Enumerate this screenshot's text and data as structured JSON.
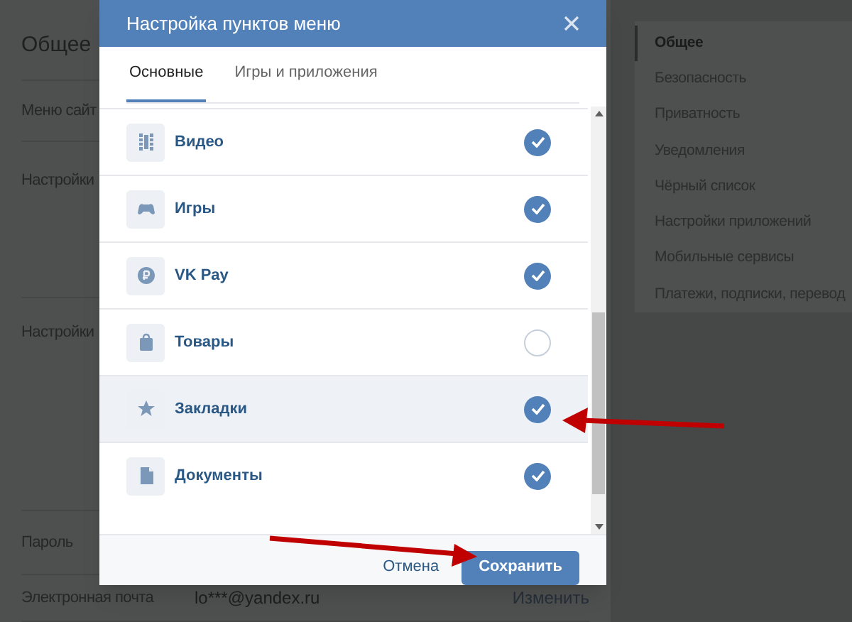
{
  "page": {
    "section_title": "Общее",
    "rows": [
      {
        "label": "Меню сайт"
      },
      {
        "label": "Настройки"
      },
      {
        "label": "Настройки"
      },
      {
        "label": "Пароль"
      },
      {
        "label": "Электронная почта",
        "value": "lo***@yandex.ru",
        "action": "Изменить"
      }
    ]
  },
  "sidebar": {
    "items": [
      {
        "label": "Общее",
        "selected": true
      },
      {
        "label": "Безопасность",
        "selected": false
      },
      {
        "label": "Приватность",
        "selected": false
      },
      {
        "label": "Уведомления",
        "selected": false
      },
      {
        "label": "Чёрный список",
        "selected": false
      },
      {
        "label": "Настройки приложений",
        "selected": false
      },
      {
        "label": "Мобильные сервисы",
        "selected": false
      },
      {
        "label": "Платежи, подписки, перевод",
        "selected": false
      }
    ]
  },
  "dialog": {
    "title": "Настройка пунктов меню",
    "tabs": [
      {
        "label": "Основные",
        "selected": true
      },
      {
        "label": "Игры и приложения",
        "selected": false
      }
    ],
    "items": [
      {
        "label": "Видео",
        "checked": true,
        "hovered": false
      },
      {
        "label": "Игры",
        "checked": true,
        "hovered": false
      },
      {
        "label": "VK Pay",
        "checked": true,
        "hovered": false
      },
      {
        "label": "Товары",
        "checked": false,
        "hovered": false
      },
      {
        "label": "Закладки",
        "checked": true,
        "hovered": true
      },
      {
        "label": "Документы",
        "checked": true,
        "hovered": false
      }
    ],
    "cancel": "Отмена",
    "save": "Сохранить"
  }
}
